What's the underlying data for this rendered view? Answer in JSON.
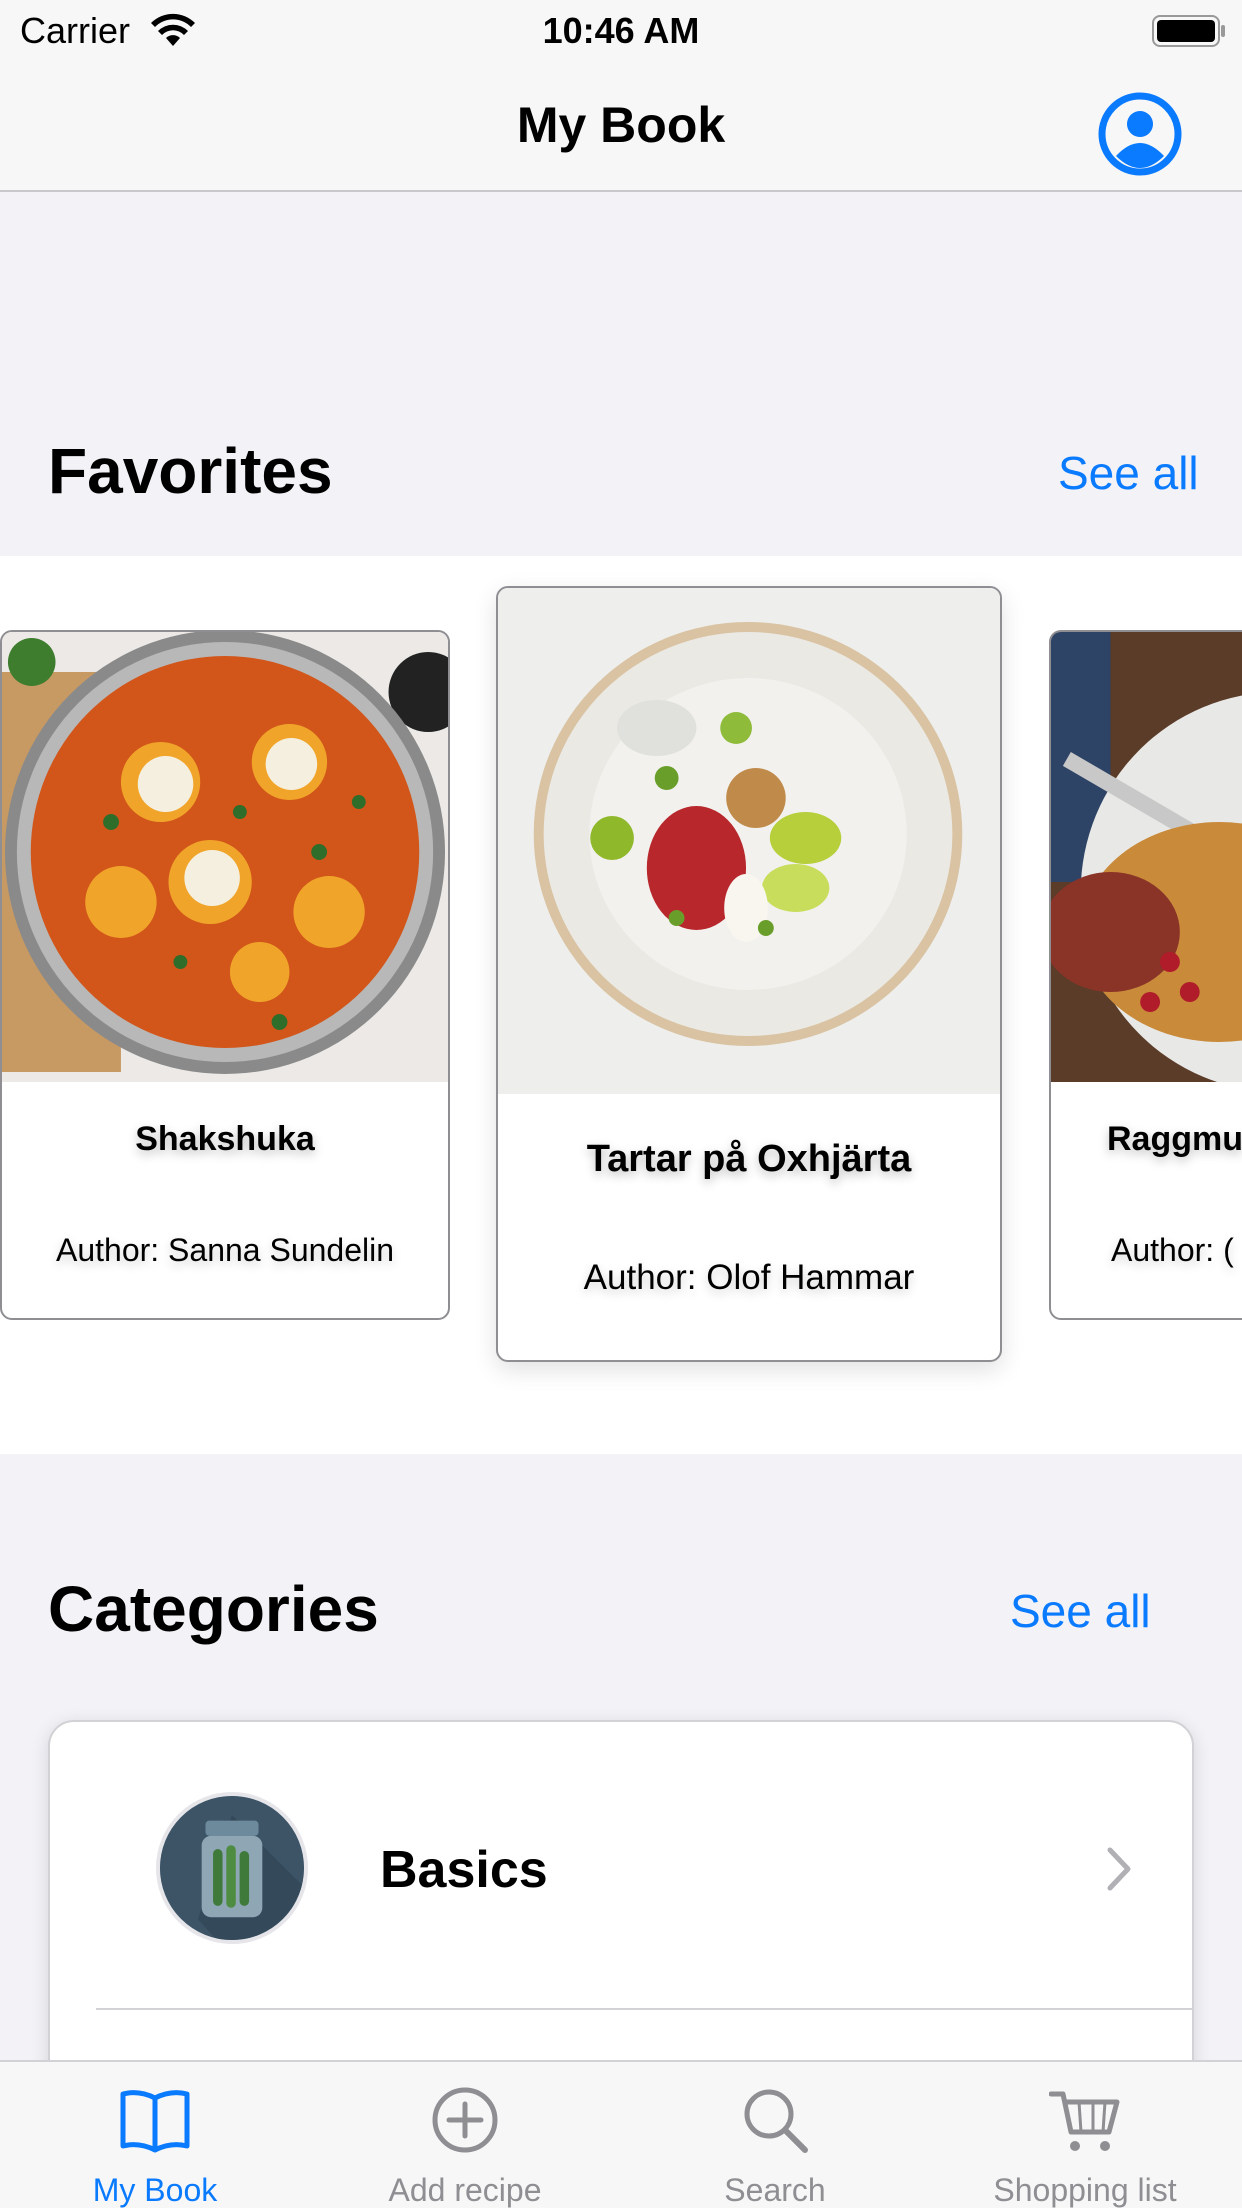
{
  "status_bar": {
    "carrier": "Carrier",
    "time": "10:46 AM"
  },
  "nav": {
    "title": "My Book",
    "profile_icon": "person-circle-icon"
  },
  "favorites": {
    "title": "Favorites",
    "see_all": "See all",
    "recipes": [
      {
        "title": "Shakshuka",
        "author": "Author: Sanna Sundelin"
      },
      {
        "title": "Tartar på Oxhjärta",
        "author": "Author: Olof Hammar"
      },
      {
        "title": "Raggmu",
        "author": "Author: ("
      }
    ]
  },
  "categories": {
    "title": "Categories",
    "see_all": "See all",
    "items": [
      {
        "label": "Basics",
        "icon": "jar-icon"
      }
    ]
  },
  "tab_bar": {
    "tabs": [
      {
        "label": "My Book",
        "icon": "book-icon",
        "active": true
      },
      {
        "label": "Add recipe",
        "icon": "plus-circle-icon",
        "active": false
      },
      {
        "label": "Search",
        "icon": "magnifier-icon",
        "active": false
      },
      {
        "label": "Shopping list",
        "icon": "cart-icon",
        "active": false
      }
    ]
  },
  "colors": {
    "accent": "#0a7aff",
    "inactive_tab": "#8e8e93",
    "background": "#f2f2f7"
  }
}
